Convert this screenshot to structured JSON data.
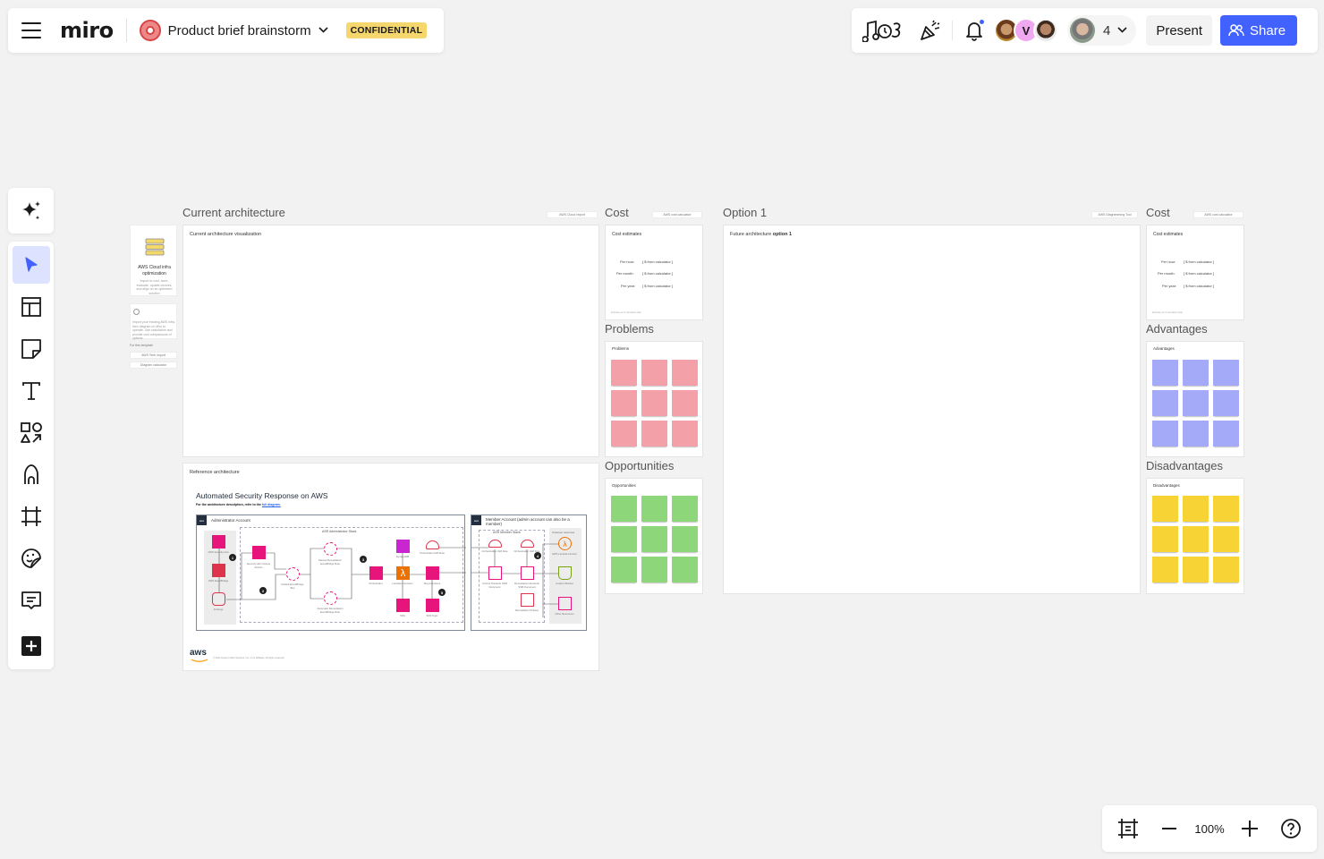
{
  "header": {
    "logo": "miro",
    "board_title": "Product brief brainstorm",
    "confidential_badge": "CONFIDENTIAL"
  },
  "topright": {
    "icons": [
      "music-timer-icon",
      "celebrate-icon",
      "bell-icon"
    ],
    "notification_dot": true,
    "avatars": [
      {
        "name": "avatar-1",
        "initial": ""
      },
      {
        "name": "avatar-v",
        "initial": "V"
      },
      {
        "name": "avatar-3",
        "initial": ""
      }
    ],
    "collaborator_count": "4",
    "present_label": "Present",
    "share_label": "Share",
    "share_color": "#4262ff"
  },
  "toolbar": {
    "ai_label": "AI assistant",
    "tools": [
      {
        "name": "select",
        "active": true
      },
      {
        "name": "templates"
      },
      {
        "name": "sticky-note"
      },
      {
        "name": "text"
      },
      {
        "name": "shapes"
      },
      {
        "name": "pen"
      },
      {
        "name": "frame"
      },
      {
        "name": "stickers"
      },
      {
        "name": "comment"
      },
      {
        "name": "more-apps"
      }
    ]
  },
  "zoom": {
    "value": "100%"
  },
  "canvas": {
    "intro_card": {
      "title": "AWS Cloud infra optimization",
      "description": "Import to cost, store, evaluate, update choices, and align on an optimized solution",
      "note": "Import your existing AWS infra, then diagram on Miro to operate. Use calculators and provide cost comparisons of options.",
      "section_label": "For this template",
      "links": [
        "AWS Tech import",
        "Diagram calculator"
      ]
    },
    "current_architecture": {
      "title": "Current architecture",
      "frame_label": "Current architecture visualization",
      "import_button": "AWS Cloud import"
    },
    "cost_left": {
      "title": "Cost",
      "calc_button": "AWS cost calculator",
      "card_title": "Cost estimates",
      "rows": [
        {
          "label": "Per hour:",
          "value": "[ $ from calculator ]"
        },
        {
          "label": "Per month:",
          "value": "[ $ from calculator ]"
        },
        {
          "label": "Per year:",
          "value": "[ $ from calculator ]"
        }
      ],
      "footnote": "Estimate as of calculation date"
    },
    "problems": {
      "title": "Problems",
      "label": "Problems",
      "color": "#f4a0a8",
      "count": 9
    },
    "opportunities": {
      "title": "Opportunities",
      "label": "Opportunities",
      "color": "#8ed67a",
      "count": 9
    },
    "reference_architecture": {
      "frame_label": "Reference architecture",
      "diagram_title": "Automated Security Response on AWS",
      "subtitle_prefix": "For the architecture description, refer to the",
      "subtitle_link": "full diagram.",
      "admin_account": "Administrator Account",
      "admin_stack": "ASR Administrator Stack",
      "member_account": "Member Account (admin account can also be a member)",
      "member_stack": "ASR Member Stack",
      "customer_resources": "Customer resources",
      "labels": {
        "security_hub": "AWS Security Hub",
        "eventbridge": "AWS EventBridge",
        "findings": "Findings",
        "custom_actions": "Security Hub Custom Actions",
        "default_bus": "Default EventBridge Bus",
        "manual_rule": "Manual Remediation EventBridge Rule",
        "auto_rule": "Automatic Remediation EventBridge Rule",
        "orchestrator": "Orchestrator",
        "dynamodb": "DynamoDB",
        "lambda": "Lambda Functions",
        "orchestrator_role": "Orchestrator IAM Role",
        "step_functions": "Step Functions",
        "sns": "SNS",
        "sns_topic": "SNS Topic",
        "member_role": "Orchestration IAM Role",
        "member_role2": "Orchestration IAM Role",
        "control_runbook": "Control Runbook SSM Document",
        "remediation_runbook": "Remediation Runbook SSM Document",
        "remediation_policies": "Remediation Policies",
        "aws_lambda_fn": "AWS Lambda function",
        "s3_bucket": "Amazon Bucket",
        "other_resources": "Other Resources"
      },
      "steps": [
        "1",
        "2",
        "3",
        "4",
        "5"
      ],
      "footer": "© 2023 Amazon Web Services, Inc. or its affiliates. All rights reserved.",
      "aws_logo": "aws"
    },
    "option1": {
      "title": "Option 1",
      "frame_label_prefix": "Future architecture",
      "frame_label_bold": "option 1",
      "diagram_button": "AWS Diagramming Tool"
    },
    "cost_right": {
      "title": "Cost",
      "calc_button": "AWS cost calculator",
      "card_title": "Cost estimates",
      "rows": [
        {
          "label": "Per hour:",
          "value": "[ $ from calculator ]"
        },
        {
          "label": "Per month:",
          "value": "[ $ from calculator ]"
        },
        {
          "label": "Per year:",
          "value": "[ $ from calculator ]"
        }
      ],
      "footnote": "Estimate as of calculation date"
    },
    "advantages": {
      "title": "Advantages",
      "label": "Advantages",
      "color": "#a4aaf8",
      "count": 9
    },
    "disadvantages": {
      "title": "Disadvantages",
      "label": "Disadvantages",
      "color": "#f7d336",
      "count": 9
    }
  }
}
